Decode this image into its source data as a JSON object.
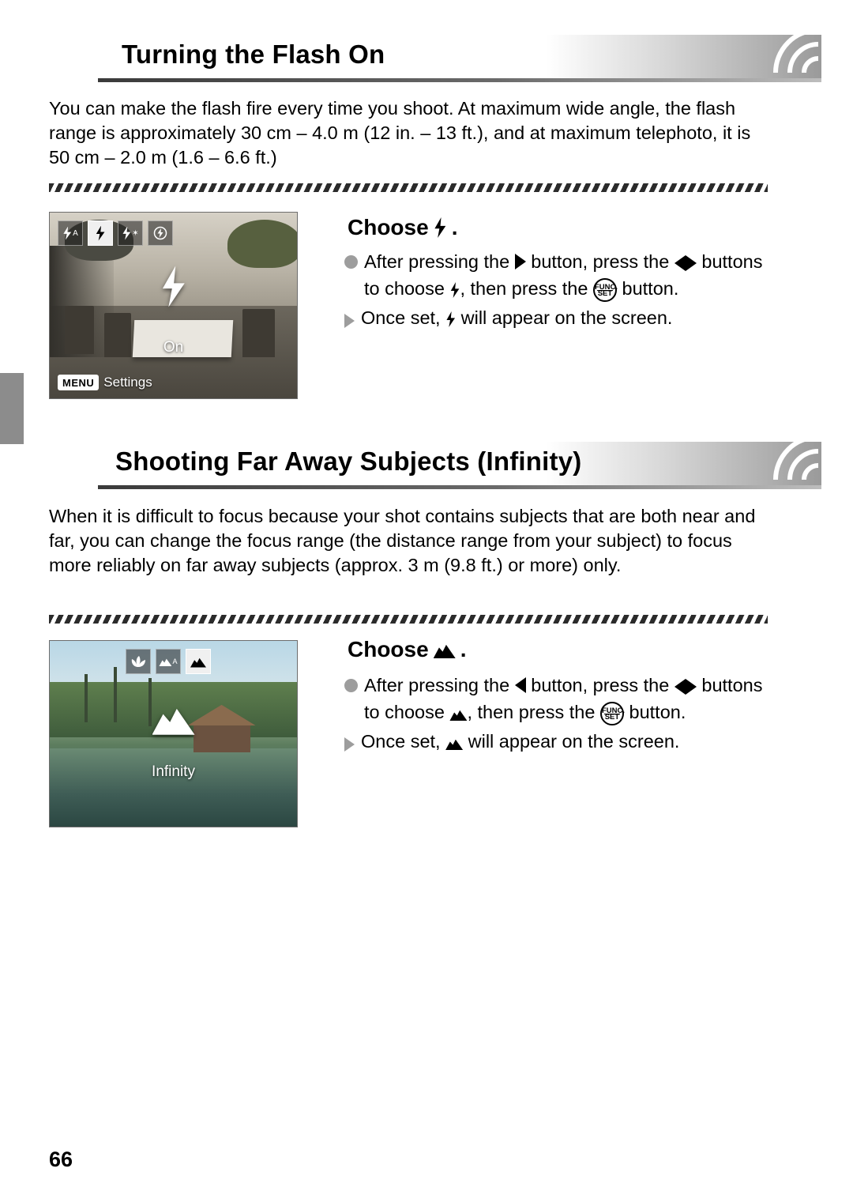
{
  "page": {
    "number": "66"
  },
  "sections": [
    {
      "id": "flash-on",
      "title": "Turning the Flash On",
      "body": "You can make the flash fire every time you shoot. At maximum wide angle, the flash range is approximately 30 cm – 4.0 m (12 in. – 13 ft.), and at maximum telephoto, it is 50 cm – 2.0 m (1.6 – 6.6 ft.)",
      "step": {
        "title_prefix": "Choose",
        "title_suffix": ".",
        "title_icon": "flash-icon",
        "bullet": {
          "part1": "After pressing the",
          "icon1": "right-arrow-button-icon",
          "part2": "button, press the",
          "icon2": "left-right-arrow-buttons-icon",
          "part3": "buttons to choose",
          "icon3": "flash-icon",
          "part4": ", then press the",
          "icon4": "func-set-button-icon",
          "part5": "button."
        },
        "result": {
          "part1": "Once set,",
          "icon1": "flash-icon",
          "part2": "will appear on the screen."
        }
      },
      "screenshot": {
        "name": "flash-mode-screen",
        "icons": [
          "flash-auto-icon",
          "flash-on-icon",
          "slow-sync-icon",
          "flash-off-icon"
        ],
        "selected_index": 1,
        "center_label": "On",
        "menu_badge": "MENU",
        "menu_text": "Settings"
      }
    },
    {
      "id": "infinity",
      "title": "Shooting Far Away Subjects (Infinity)",
      "body": "When it is difficult to focus because your shot contains subjects that are both near and far, you can change the focus range (the distance range from your subject) to focus more reliably on far away subjects (approx. 3 m (9.8 ft.) or more) only.",
      "step": {
        "title_prefix": "Choose",
        "title_suffix": ".",
        "title_icon": "infinity-icon",
        "bullet": {
          "part1": "After pressing the",
          "icon1": "left-arrow-button-icon",
          "part2": "button, press the",
          "icon2": "left-right-arrow-buttons-icon",
          "part3": "buttons to choose",
          "icon3": "infinity-icon",
          "part4": ", then press the",
          "icon4": "func-set-button-icon",
          "part5": "button."
        },
        "result": {
          "part1": "Once set,",
          "icon1": "infinity-icon",
          "part2": "will appear on the screen."
        }
      },
      "screenshot": {
        "name": "focus-range-screen",
        "icons": [
          "macro-icon",
          "normal-af-icon",
          "infinity-icon"
        ],
        "selected_index": 2,
        "center_label": "Infinity"
      }
    }
  ],
  "func_set_button": {
    "top": "FUNC.",
    "bottom": "SET"
  }
}
